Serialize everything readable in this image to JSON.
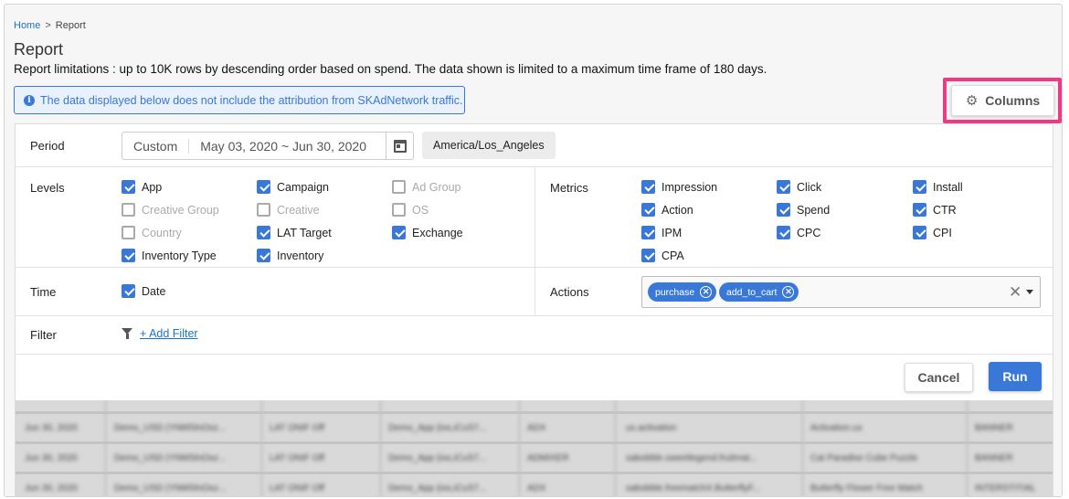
{
  "breadcrumb": {
    "home": "Home",
    "separator": ">",
    "current": "Report"
  },
  "page": {
    "title": "Report",
    "limits": "Report limitations : up to 10K rows by descending order based on spend. The data shown is limited to a maximum time frame of 180 days.",
    "notice": "The data displayed below does not include the attribution from SKAdNetwork traffic.",
    "notice_icon": "info-icon"
  },
  "columns_button": {
    "label": "Columns",
    "icon": "gear-icon",
    "highlight_color": "#ec3b83"
  },
  "period": {
    "label": "Period",
    "mode": "Custom",
    "range": "May 03, 2020 ~ Jun 30, 2020",
    "timezone": "America/Los_Angeles"
  },
  "levels": {
    "label": "Levels",
    "items": [
      {
        "label": "App",
        "checked": true,
        "enabled": true
      },
      {
        "label": "Campaign",
        "checked": true,
        "enabled": true
      },
      {
        "label": "Ad Group",
        "checked": false,
        "enabled": false
      },
      {
        "label": "Creative Group",
        "checked": false,
        "enabled": false
      },
      {
        "label": "Creative",
        "checked": false,
        "enabled": false
      },
      {
        "label": "OS",
        "checked": false,
        "enabled": false
      },
      {
        "label": "Country",
        "checked": false,
        "enabled": false
      },
      {
        "label": "LAT Target",
        "checked": true,
        "enabled": true
      },
      {
        "label": "Exchange",
        "checked": true,
        "enabled": true
      },
      {
        "label": "Inventory Type",
        "checked": true,
        "enabled": true
      },
      {
        "label": "Inventory",
        "checked": true,
        "enabled": true
      }
    ]
  },
  "metrics": {
    "label": "Metrics",
    "items": [
      {
        "label": "Impression",
        "checked": true
      },
      {
        "label": "Click",
        "checked": true
      },
      {
        "label": "Install",
        "checked": true
      },
      {
        "label": "Action",
        "checked": true
      },
      {
        "label": "Spend",
        "checked": true
      },
      {
        "label": "CTR",
        "checked": true
      },
      {
        "label": "IPM",
        "checked": true
      },
      {
        "label": "CPC",
        "checked": true
      },
      {
        "label": "CPI",
        "checked": true
      },
      {
        "label": "CPA",
        "checked": true
      }
    ]
  },
  "time": {
    "label": "Time",
    "items": [
      {
        "label": "Date",
        "checked": true
      }
    ]
  },
  "actions": {
    "label": "Actions",
    "chips": [
      "purchase",
      "add_to_cart"
    ]
  },
  "filter": {
    "label": "Filter",
    "add_label": "+ Add Filter"
  },
  "buttons": {
    "cancel": "Cancel",
    "run": "Run",
    "accent": "#3a78d8"
  },
  "table": {
    "rows": [
      [
        "Jun 30, 2020",
        "Demo_USD (YNMSlnOsz...",
        "LAT ONIF Off",
        "Demo_App (ios,iCuS7...",
        "ADX",
        "ux.activation",
        "Activation.ux",
        "BANNER"
      ],
      [
        "Jun 30, 2020",
        "Demo_USD (YNMSlnOsz...",
        "LAT ONIF Off",
        "Demo_App (ios,iCuS7...",
        "ADMIXER",
        "sabobble.sweetlegend.fruitmat...",
        "Cat Paradise Cube Puzzle",
        "BANNER"
      ],
      [
        "Jun 30, 2020",
        "Demo_USD (YNMSlnOsz...",
        "LAT ONIF Off",
        "Demo_App (ios,iCuS7...",
        "ADX",
        "sabobble.freematchX.ButterflyF...",
        "Butterfly Flower Free Match",
        "INTERSTITIAL"
      ]
    ]
  }
}
